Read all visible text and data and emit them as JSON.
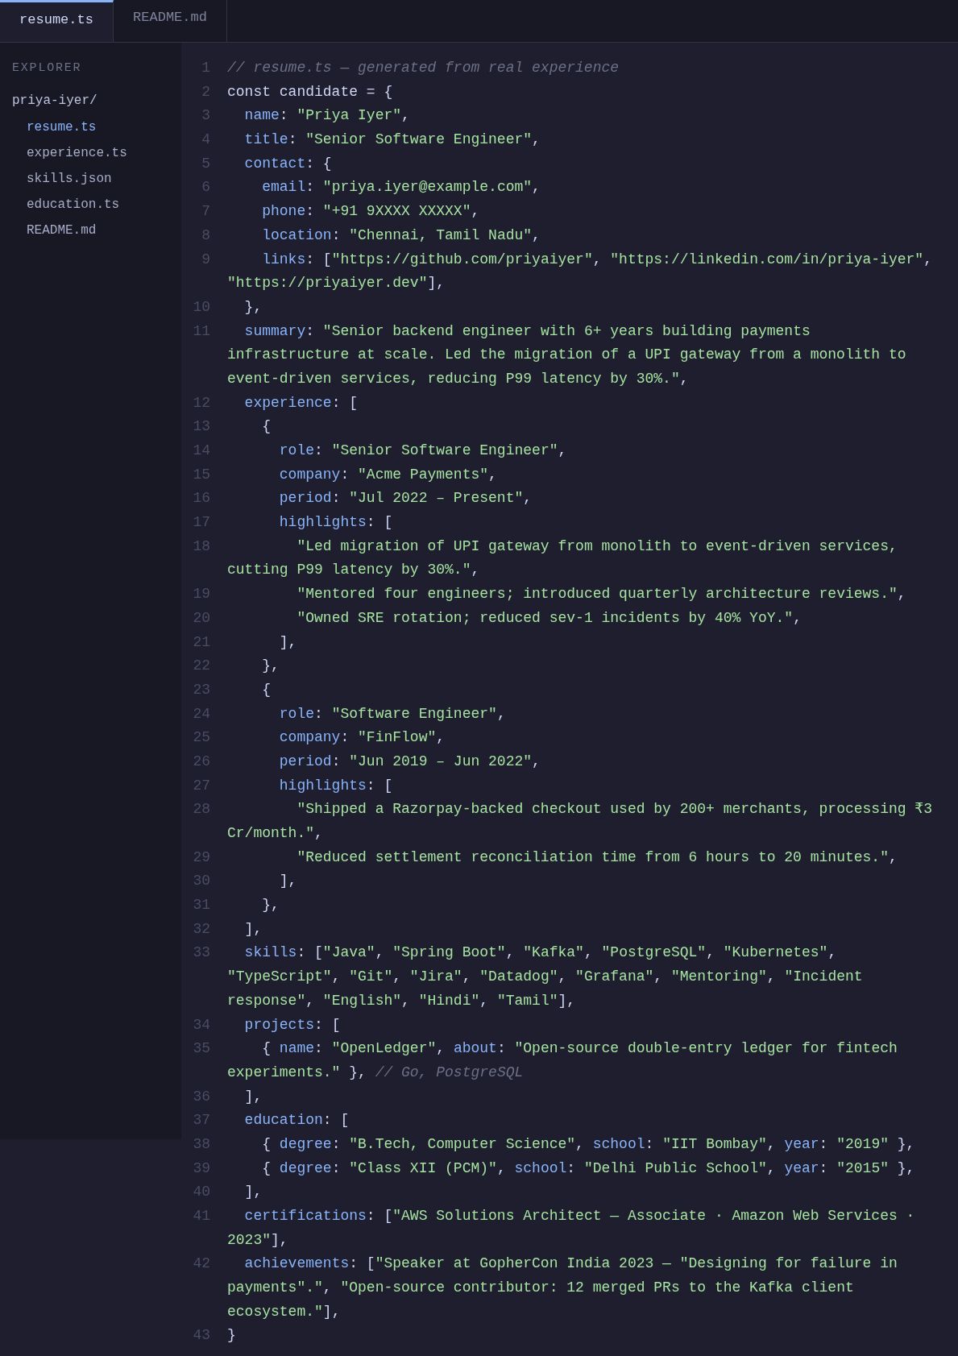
{
  "tabs": [
    {
      "label": "resume.ts",
      "selected": true
    },
    {
      "label": "README.md",
      "selected": false
    }
  ],
  "sidebar": {
    "title": "EXPLORER",
    "tree": {
      "name": "priya-iyer/",
      "children": [
        {
          "name": "resume.ts",
          "selected": true
        },
        {
          "name": "experience.ts",
          "selected": false
        },
        {
          "name": "skills.json",
          "selected": false
        },
        {
          "name": "education.ts",
          "selected": false
        },
        {
          "name": "README.md",
          "selected": false
        }
      ]
    }
  },
  "editor": {
    "lines": [
      {
        "number": "1",
        "tokens": [
          {
            "kind": "comment",
            "text": "// resume.ts — generated from real experience"
          }
        ]
      },
      {
        "number": "2",
        "tokens": [
          {
            "kind": "plain",
            "text": "const candidate = {"
          }
        ]
      },
      {
        "number": "3",
        "tokens": [
          {
            "kind": "key",
            "text": "  name"
          },
          {
            "kind": "plain",
            "text": ": "
          },
          {
            "kind": "string",
            "text": "\"Priya Iyer\""
          },
          {
            "kind": "plain",
            "text": ","
          }
        ]
      },
      {
        "number": "4",
        "tokens": [
          {
            "kind": "key",
            "text": "  title"
          },
          {
            "kind": "plain",
            "text": ": "
          },
          {
            "kind": "string",
            "text": "\"Senior Software Engineer\""
          },
          {
            "kind": "plain",
            "text": ","
          }
        ]
      },
      {
        "number": "5",
        "tokens": [
          {
            "kind": "key",
            "text": "  contact"
          },
          {
            "kind": "plain",
            "text": ": {"
          }
        ]
      },
      {
        "number": "6",
        "tokens": [
          {
            "kind": "key",
            "text": "    email"
          },
          {
            "kind": "plain",
            "text": ": "
          },
          {
            "kind": "string",
            "text": "\"priya.iyer@example.com\""
          },
          {
            "kind": "plain",
            "text": ","
          }
        ]
      },
      {
        "number": "7",
        "tokens": [
          {
            "kind": "key",
            "text": "    phone"
          },
          {
            "kind": "plain",
            "text": ": "
          },
          {
            "kind": "string",
            "text": "\"+91 9XXXX XXXXX\""
          },
          {
            "kind": "plain",
            "text": ","
          }
        ]
      },
      {
        "number": "8",
        "tokens": [
          {
            "kind": "key",
            "text": "    location"
          },
          {
            "kind": "plain",
            "text": ": "
          },
          {
            "kind": "string",
            "text": "\"Chennai, Tamil Nadu\""
          },
          {
            "kind": "plain",
            "text": ","
          }
        ]
      },
      {
        "number": "9",
        "tokens": [
          {
            "kind": "key",
            "text": "    links"
          },
          {
            "kind": "plain",
            "text": ": ["
          },
          {
            "kind": "string",
            "text": "\"https://github.com/priyaiyer\""
          },
          {
            "kind": "plain",
            "text": ", "
          },
          {
            "kind": "string",
            "text": "\"https://linkedin.com/in/priya-iyer\""
          },
          {
            "kind": "plain",
            "text": ", "
          },
          {
            "kind": "string",
            "text": "\"https://priyaiyer.dev\""
          },
          {
            "kind": "plain",
            "text": "],"
          }
        ]
      },
      {
        "number": "10",
        "tokens": [
          {
            "kind": "plain",
            "text": "  },"
          }
        ]
      },
      {
        "number": "11",
        "tokens": [
          {
            "kind": "key",
            "text": "  summary"
          },
          {
            "kind": "plain",
            "text": ": "
          },
          {
            "kind": "string",
            "text": "\"Senior backend engineer with 6+ years building payments infrastructure at scale. Led the migration of a UPI gateway from a monolith to event-driven services, reducing P99 latency by 30%.\""
          },
          {
            "kind": "plain",
            "text": ","
          }
        ]
      },
      {
        "number": "12",
        "tokens": [
          {
            "kind": "key",
            "text": "  experience"
          },
          {
            "kind": "plain",
            "text": ": ["
          }
        ]
      },
      {
        "number": "13",
        "tokens": [
          {
            "kind": "plain",
            "text": "    {"
          }
        ]
      },
      {
        "number": "14",
        "tokens": [
          {
            "kind": "key",
            "text": "      role"
          },
          {
            "kind": "plain",
            "text": ": "
          },
          {
            "kind": "string",
            "text": "\"Senior Software Engineer\""
          },
          {
            "kind": "plain",
            "text": ","
          }
        ]
      },
      {
        "number": "15",
        "tokens": [
          {
            "kind": "key",
            "text": "      company"
          },
          {
            "kind": "plain",
            "text": ": "
          },
          {
            "kind": "string",
            "text": "\"Acme Payments\""
          },
          {
            "kind": "plain",
            "text": ","
          }
        ]
      },
      {
        "number": "16",
        "tokens": [
          {
            "kind": "key",
            "text": "      period"
          },
          {
            "kind": "plain",
            "text": ": "
          },
          {
            "kind": "string",
            "text": "\"Jul 2022 – Present\""
          },
          {
            "kind": "plain",
            "text": ","
          }
        ]
      },
      {
        "number": "17",
        "tokens": [
          {
            "kind": "key",
            "text": "      highlights"
          },
          {
            "kind": "plain",
            "text": ": ["
          }
        ]
      },
      {
        "number": "18",
        "tokens": [
          {
            "kind": "string",
            "text": "        \"Led migration of UPI gateway from monolith to event-driven services, cutting P99 latency by 30%.\""
          },
          {
            "kind": "plain",
            "text": ","
          }
        ]
      },
      {
        "number": "19",
        "tokens": [
          {
            "kind": "string",
            "text": "        \"Mentored four engineers; introduced quarterly architecture reviews.\""
          },
          {
            "kind": "plain",
            "text": ","
          }
        ]
      },
      {
        "number": "20",
        "tokens": [
          {
            "kind": "string",
            "text": "        \"Owned SRE rotation; reduced sev-1 incidents by 40% YoY.\""
          },
          {
            "kind": "plain",
            "text": ","
          }
        ]
      },
      {
        "number": "21",
        "tokens": [
          {
            "kind": "plain",
            "text": "      ],"
          }
        ]
      },
      {
        "number": "22",
        "tokens": [
          {
            "kind": "plain",
            "text": "    },"
          }
        ]
      },
      {
        "number": "23",
        "tokens": [
          {
            "kind": "plain",
            "text": "    {"
          }
        ]
      },
      {
        "number": "24",
        "tokens": [
          {
            "kind": "key",
            "text": "      role"
          },
          {
            "kind": "plain",
            "text": ": "
          },
          {
            "kind": "string",
            "text": "\"Software Engineer\""
          },
          {
            "kind": "plain",
            "text": ","
          }
        ]
      },
      {
        "number": "25",
        "tokens": [
          {
            "kind": "key",
            "text": "      company"
          },
          {
            "kind": "plain",
            "text": ": "
          },
          {
            "kind": "string",
            "text": "\"FinFlow\""
          },
          {
            "kind": "plain",
            "text": ","
          }
        ]
      },
      {
        "number": "26",
        "tokens": [
          {
            "kind": "key",
            "text": "      period"
          },
          {
            "kind": "plain",
            "text": ": "
          },
          {
            "kind": "string",
            "text": "\"Jun 2019 – Jun 2022\""
          },
          {
            "kind": "plain",
            "text": ","
          }
        ]
      },
      {
        "number": "27",
        "tokens": [
          {
            "kind": "key",
            "text": "      highlights"
          },
          {
            "kind": "plain",
            "text": ": ["
          }
        ]
      },
      {
        "number": "28",
        "tokens": [
          {
            "kind": "string",
            "text": "        \"Shipped a Razorpay-backed checkout used by 200+ merchants, processing ₹3 Cr/month.\""
          },
          {
            "kind": "plain",
            "text": ","
          }
        ]
      },
      {
        "number": "29",
        "tokens": [
          {
            "kind": "string",
            "text": "        \"Reduced settlement reconciliation time from 6 hours to 20 minutes.\""
          },
          {
            "kind": "plain",
            "text": ","
          }
        ]
      },
      {
        "number": "30",
        "tokens": [
          {
            "kind": "plain",
            "text": "      ],"
          }
        ]
      },
      {
        "number": "31",
        "tokens": [
          {
            "kind": "plain",
            "text": "    },"
          }
        ]
      },
      {
        "number": "32",
        "tokens": [
          {
            "kind": "plain",
            "text": "  ],"
          }
        ]
      },
      {
        "number": "33",
        "tokens": [
          {
            "kind": "key",
            "text": "  skills"
          },
          {
            "kind": "plain",
            "text": ": ["
          },
          {
            "kind": "string",
            "text": "\"Java\""
          },
          {
            "kind": "plain",
            "text": ", "
          },
          {
            "kind": "string",
            "text": "\"Spring Boot\""
          },
          {
            "kind": "plain",
            "text": ", "
          },
          {
            "kind": "string",
            "text": "\"Kafka\""
          },
          {
            "kind": "plain",
            "text": ", "
          },
          {
            "kind": "string",
            "text": "\"PostgreSQL\""
          },
          {
            "kind": "plain",
            "text": ", "
          },
          {
            "kind": "string",
            "text": "\"Kubernetes\""
          },
          {
            "kind": "plain",
            "text": ", "
          },
          {
            "kind": "string",
            "text": "\"TypeScript\""
          },
          {
            "kind": "plain",
            "text": ", "
          },
          {
            "kind": "string",
            "text": "\"Git\""
          },
          {
            "kind": "plain",
            "text": ", "
          },
          {
            "kind": "string",
            "text": "\"Jira\""
          },
          {
            "kind": "plain",
            "text": ", "
          },
          {
            "kind": "string",
            "text": "\"Datadog\""
          },
          {
            "kind": "plain",
            "text": ", "
          },
          {
            "kind": "string",
            "text": "\"Grafana\""
          },
          {
            "kind": "plain",
            "text": ", "
          },
          {
            "kind": "string",
            "text": "\"Mentoring\""
          },
          {
            "kind": "plain",
            "text": ", "
          },
          {
            "kind": "string",
            "text": "\"Incident response\""
          },
          {
            "kind": "plain",
            "text": ", "
          },
          {
            "kind": "string",
            "text": "\"English\""
          },
          {
            "kind": "plain",
            "text": ", "
          },
          {
            "kind": "string",
            "text": "\"Hindi\""
          },
          {
            "kind": "plain",
            "text": ", "
          },
          {
            "kind": "string",
            "text": "\"Tamil\""
          },
          {
            "kind": "plain",
            "text": "],"
          }
        ]
      },
      {
        "number": "34",
        "tokens": [
          {
            "kind": "key",
            "text": "  projects"
          },
          {
            "kind": "plain",
            "text": ": ["
          }
        ]
      },
      {
        "number": "35",
        "tokens": [
          {
            "kind": "plain",
            "text": "    { "
          },
          {
            "kind": "key",
            "text": "name"
          },
          {
            "kind": "plain",
            "text": ": "
          },
          {
            "kind": "string",
            "text": "\"OpenLedger\""
          },
          {
            "kind": "plain",
            "text": ", "
          },
          {
            "kind": "key",
            "text": "about"
          },
          {
            "kind": "plain",
            "text": ": "
          },
          {
            "kind": "string",
            "text": "\"Open-source double-entry ledger for fintech experiments.\""
          },
          {
            "kind": "plain",
            "text": " }, "
          },
          {
            "kind": "comment",
            "text": "// Go, PostgreSQL"
          }
        ]
      },
      {
        "number": "36",
        "tokens": [
          {
            "kind": "plain",
            "text": "  ],"
          }
        ]
      },
      {
        "number": "37",
        "tokens": [
          {
            "kind": "key",
            "text": "  education"
          },
          {
            "kind": "plain",
            "text": ": ["
          }
        ]
      },
      {
        "number": "38",
        "tokens": [
          {
            "kind": "plain",
            "text": "    { "
          },
          {
            "kind": "key",
            "text": "degree"
          },
          {
            "kind": "plain",
            "text": ": "
          },
          {
            "kind": "string",
            "text": "\"B.Tech, Computer Science\""
          },
          {
            "kind": "plain",
            "text": ", "
          },
          {
            "kind": "key",
            "text": "school"
          },
          {
            "kind": "plain",
            "text": ": "
          },
          {
            "kind": "string",
            "text": "\"IIT Bombay\""
          },
          {
            "kind": "plain",
            "text": ", "
          },
          {
            "kind": "key",
            "text": "year"
          },
          {
            "kind": "plain",
            "text": ": "
          },
          {
            "kind": "string",
            "text": "\"2019\""
          },
          {
            "kind": "plain",
            "text": " },"
          }
        ]
      },
      {
        "number": "39",
        "tokens": [
          {
            "kind": "plain",
            "text": "    { "
          },
          {
            "kind": "key",
            "text": "degree"
          },
          {
            "kind": "plain",
            "text": ": "
          },
          {
            "kind": "string",
            "text": "\"Class XII (PCM)\""
          },
          {
            "kind": "plain",
            "text": ", "
          },
          {
            "kind": "key",
            "text": "school"
          },
          {
            "kind": "plain",
            "text": ": "
          },
          {
            "kind": "string",
            "text": "\"Delhi Public School\""
          },
          {
            "kind": "plain",
            "text": ", "
          },
          {
            "kind": "key",
            "text": "year"
          },
          {
            "kind": "plain",
            "text": ": "
          },
          {
            "kind": "string",
            "text": "\"2015\""
          },
          {
            "kind": "plain",
            "text": " },"
          }
        ]
      },
      {
        "number": "40",
        "tokens": [
          {
            "kind": "plain",
            "text": "  ],"
          }
        ]
      },
      {
        "number": "41",
        "tokens": [
          {
            "kind": "key",
            "text": "  certifications"
          },
          {
            "kind": "plain",
            "text": ": ["
          },
          {
            "kind": "string",
            "text": "\"AWS Solutions Architect — Associate · Amazon Web Services · 2023\""
          },
          {
            "kind": "plain",
            "text": "],"
          }
        ]
      },
      {
        "number": "42",
        "tokens": [
          {
            "kind": "key",
            "text": "  achievements"
          },
          {
            "kind": "plain",
            "text": ": ["
          },
          {
            "kind": "string",
            "text": "\"Speaker at GopherCon India 2023 — \"Designing for failure in payments\".\""
          },
          {
            "kind": "plain",
            "text": ", "
          },
          {
            "kind": "string",
            "text": "\"Open-source contributor: 12 merged PRs to the Kafka client ecosystem.\""
          },
          {
            "kind": "plain",
            "text": "],"
          }
        ]
      },
      {
        "number": "43",
        "tokens": [
          {
            "kind": "plain",
            "text": "}"
          }
        ]
      }
    ]
  }
}
